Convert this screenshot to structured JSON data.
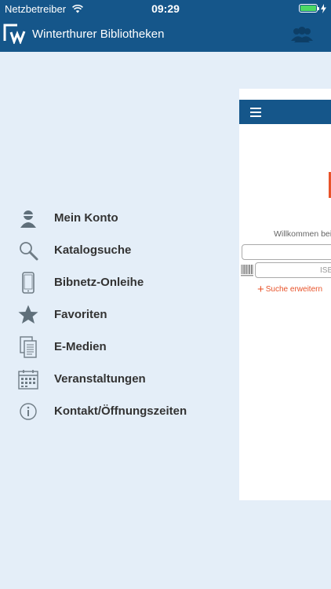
{
  "status_bar": {
    "carrier": "Netzbetreiber",
    "time": "09:29"
  },
  "header": {
    "title": "Winterthurer Bibliotheken"
  },
  "menu": {
    "items": [
      {
        "label": "Mein Konto",
        "icon": "person-icon"
      },
      {
        "label": "Katalogsuche",
        "icon": "search-icon"
      },
      {
        "label": "Bibnetz-Onleihe",
        "icon": "phone-icon"
      },
      {
        "label": "Favoriten",
        "icon": "star-icon"
      },
      {
        "label": "E-Medien",
        "icon": "documents-icon"
      },
      {
        "label": "Veranstaltungen",
        "icon": "calendar-icon"
      },
      {
        "label": "Kontakt/Öffnungszeiten",
        "icon": "info-icon"
      }
    ]
  },
  "preview": {
    "welcome": "Willkommen bei",
    "isbn_placeholder": "ISB",
    "extend_search": "Suche erweitern"
  },
  "colors": {
    "brand": "#15568a",
    "accent": "#e8532a",
    "background": "#e4eef8"
  }
}
